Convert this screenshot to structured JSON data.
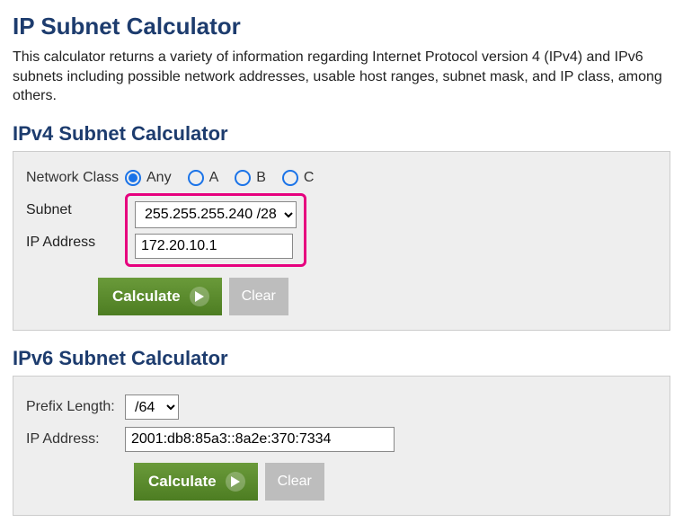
{
  "page": {
    "title": "IP Subnet Calculator",
    "intro": "This calculator returns a variety of information regarding Internet Protocol version 4 (IPv4) and IPv6 subnets including possible network addresses, usable host ranges, subnet mask, and IP class, among others."
  },
  "ipv4": {
    "heading": "IPv4 Subnet Calculator",
    "network_class_label": "Network Class",
    "network_class_options": [
      "Any",
      "A",
      "B",
      "C"
    ],
    "network_class_selected": "Any",
    "subnet_label": "Subnet",
    "subnet_value": "255.255.255.240 /28",
    "ip_label": "IP Address",
    "ip_value": "172.20.10.1",
    "calculate_label": "Calculate",
    "clear_label": "Clear"
  },
  "ipv6": {
    "heading": "IPv6 Subnet Calculator",
    "prefix_label": "Prefix Length:",
    "prefix_value": "/64",
    "ip_label": "IP Address:",
    "ip_value": "2001:db8:85a3::8a2e:370:7334",
    "calculate_label": "Calculate",
    "clear_label": "Clear"
  }
}
